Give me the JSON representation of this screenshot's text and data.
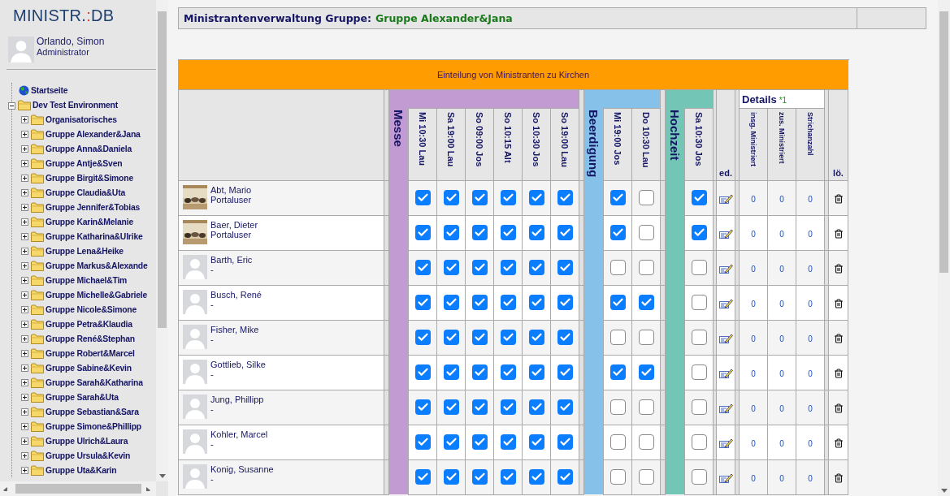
{
  "logo": {
    "name": "MINISTR.",
    "separator": ":",
    "suffix": "DB"
  },
  "user": {
    "name": "Orlando, Simon",
    "role": "Administrator"
  },
  "tree": [
    {
      "label": "Startseite",
      "kind": "home"
    },
    {
      "label": "Dev Test Environment",
      "kind": "folder",
      "expanded": true,
      "children": [
        {
          "label": "Organisatorisches",
          "expanded": false
        },
        {
          "label": "Gruppe Alexander&Jana",
          "expanded": false
        },
        {
          "label": "Gruppe Anna&Daniela",
          "expanded": false
        },
        {
          "label": "Gruppe Antje&Sven",
          "expanded": false
        },
        {
          "label": "Gruppe Birgit&Simone",
          "expanded": false
        },
        {
          "label": "Gruppe Claudia&Uta",
          "expanded": false
        },
        {
          "label": "Gruppe Jennifer&Tobias",
          "expanded": false
        },
        {
          "label": "Gruppe Karin&Melanie",
          "expanded": false
        },
        {
          "label": "Gruppe Katharina&Ulrike",
          "expanded": false
        },
        {
          "label": "Gruppe Lena&Heike",
          "expanded": false
        },
        {
          "label": "Gruppe Markus&Alexande",
          "expanded": false
        },
        {
          "label": "Gruppe Michael&Tim",
          "expanded": false
        },
        {
          "label": "Gruppe Michelle&Gabriele",
          "expanded": false
        },
        {
          "label": "Gruppe Nicole&Simone",
          "expanded": false
        },
        {
          "label": "Gruppe Petra&Klaudia",
          "expanded": false
        },
        {
          "label": "Gruppe René&Stephan",
          "expanded": false
        },
        {
          "label": "Gruppe Robert&Marcel",
          "expanded": false
        },
        {
          "label": "Gruppe Sabine&Kevin",
          "expanded": false
        },
        {
          "label": "Gruppe Sarah&Katharina",
          "expanded": false
        },
        {
          "label": "Gruppe Sarah&Uta",
          "expanded": false
        },
        {
          "label": "Gruppe Sebastian&Sara",
          "expanded": false
        },
        {
          "label": "Gruppe Simone&Phillipp",
          "expanded": false
        },
        {
          "label": "Gruppe Ulrich&Laura",
          "expanded": false
        },
        {
          "label": "Gruppe Ursula&Kevin",
          "expanded": false
        },
        {
          "label": "Gruppe Uta&Karin",
          "expanded": false
        }
      ]
    }
  ],
  "header": {
    "title": "Ministrantenverwaltung Gruppe:",
    "group": "Gruppe Alexander&Jana"
  },
  "table": {
    "caption": "Einteilung von Ministranten zu Kirchen",
    "categories": [
      {
        "name": "Messe",
        "color": "#c39bd3",
        "services": [
          "Mi 10:30 Lau",
          "Sa 19:00 Lau",
          "So 09:00 Jos",
          "So 10:15 Alt",
          "So 10:30 Jos",
          "So 19:00 Lau"
        ]
      },
      {
        "name": "Beerdigung",
        "color": "#85c1e9",
        "services": [
          "Mi 19:00 Jos",
          "Do 10:30 Lau"
        ]
      },
      {
        "name": "Hochzeit",
        "color": "#73c6b6",
        "services": [
          "Sa 10:30 Jos"
        ]
      }
    ],
    "edit_label": "ed.",
    "details": {
      "title": "Details",
      "note": "*1",
      "columns": [
        "insg. Ministriert",
        "zus. Ministriert",
        "Strichanzahl"
      ]
    },
    "delete_label": "lö.",
    "rows": [
      {
        "name": "Abt, Mario",
        "role": "Portaluser",
        "checks": [
          true,
          true,
          true,
          true,
          true,
          true,
          true,
          false,
          true
        ],
        "counts": [
          "0",
          "0",
          "0"
        ]
      },
      {
        "name": "Baer, Dieter",
        "role": "Portaluser",
        "checks": [
          true,
          true,
          true,
          true,
          true,
          true,
          true,
          false,
          true
        ],
        "counts": [
          "0",
          "0",
          "0"
        ]
      },
      {
        "name": "Barth, Eric",
        "role": "-",
        "avatar": {
          "kind": "silhouette"
        },
        "checks": [
          true,
          true,
          true,
          true,
          true,
          true,
          false,
          false,
          false
        ],
        "counts": [
          "0",
          "0",
          "0"
        ]
      },
      {
        "name": "Busch, René",
        "role": "-",
        "avatar": {
          "kind": "silhouette"
        },
        "checks": [
          true,
          true,
          true,
          true,
          true,
          true,
          true,
          true,
          false
        ],
        "counts": [
          "0",
          "0",
          "0"
        ]
      },
      {
        "name": "Fisher, Mike",
        "role": "-",
        "avatar": {
          "kind": "silhouette"
        },
        "checks": [
          true,
          true,
          true,
          true,
          true,
          true,
          false,
          false,
          false
        ],
        "counts": [
          "0",
          "0",
          "0"
        ]
      },
      {
        "name": "Gottlieb, Silke",
        "role": "-",
        "avatar": {
          "kind": "silhouette"
        },
        "checks": [
          true,
          true,
          true,
          true,
          true,
          true,
          true,
          true,
          false
        ],
        "counts": [
          "0",
          "0",
          "0"
        ]
      },
      {
        "name": "Jung, Phillipp",
        "role": "-",
        "avatar": {
          "kind": "silhouette"
        },
        "checks": [
          true,
          true,
          true,
          true,
          true,
          true,
          false,
          false,
          false
        ],
        "counts": [
          "0",
          "0",
          "0"
        ]
      },
      {
        "name": "Kohler, Marcel",
        "role": "-",
        "avatar": {
          "kind": "silhouette"
        },
        "checks": [
          true,
          true,
          true,
          true,
          true,
          true,
          false,
          false,
          false
        ],
        "counts": [
          "0",
          "0",
          "0"
        ]
      },
      {
        "name": "Konig, Susanne",
        "role": "-",
        "avatar": {
          "kind": "silhouette"
        },
        "checks": [
          true,
          true,
          true,
          true,
          true,
          true,
          false,
          false,
          false
        ],
        "counts": [
          "0",
          "0",
          "0"
        ]
      }
    ]
  }
}
